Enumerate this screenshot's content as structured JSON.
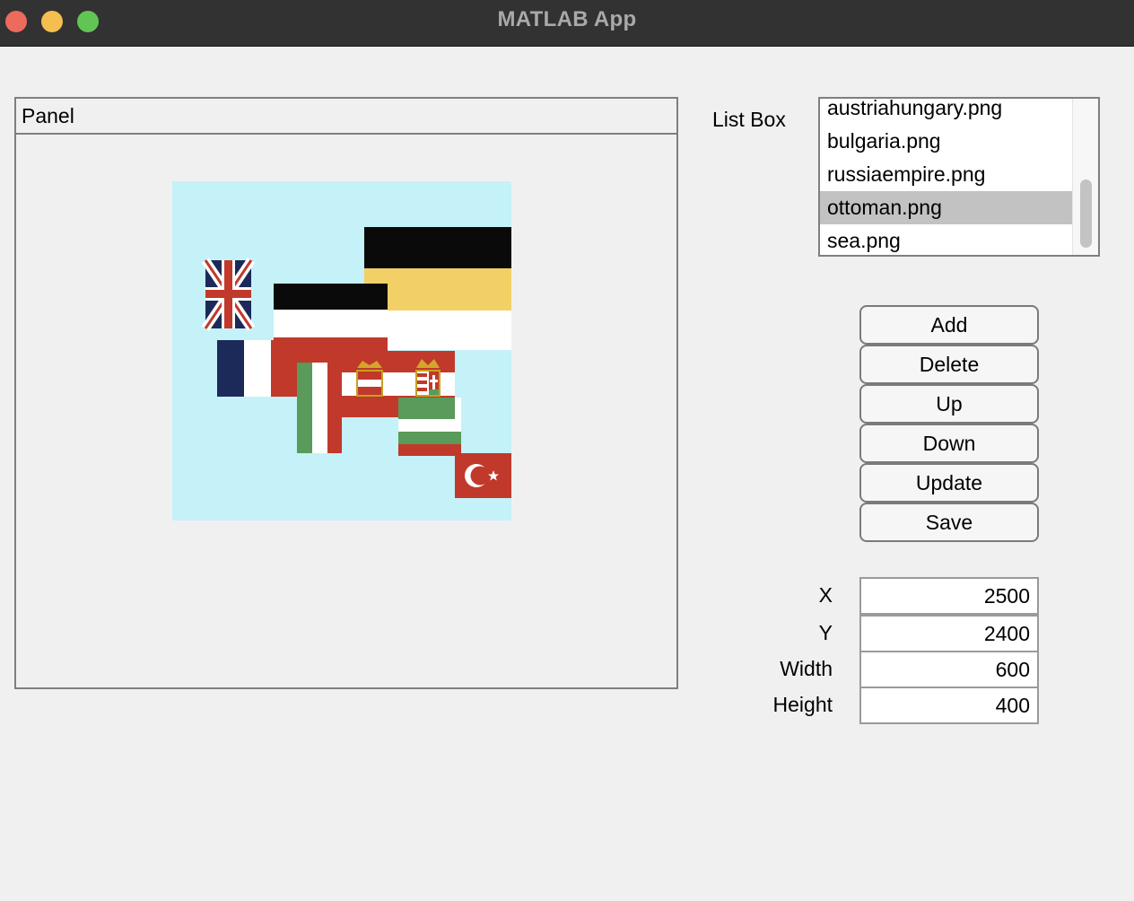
{
  "window": {
    "title": "MATLAB App"
  },
  "panel": {
    "title": "Panel"
  },
  "listbox": {
    "label": "List Box",
    "items": [
      {
        "label": "austriahungary.png",
        "selected": false
      },
      {
        "label": "bulgaria.png",
        "selected": false
      },
      {
        "label": "russiaempire.png",
        "selected": false
      },
      {
        "label": "ottoman.png",
        "selected": true
      },
      {
        "label": "sea.png",
        "selected": false
      }
    ]
  },
  "buttons": {
    "add": "Add",
    "delete": "Delete",
    "up": "Up",
    "down": "Down",
    "update": "Update",
    "save": "Save"
  },
  "fields": {
    "x": {
      "label": "X",
      "value": "2500"
    },
    "y": {
      "label": "Y",
      "value": "2400"
    },
    "width": {
      "label": "Width",
      "value": "600"
    },
    "height": {
      "label": "Height",
      "value": "400"
    }
  },
  "map": {
    "sea_color": "#c5f1f8",
    "flags": [
      "uk",
      "germany",
      "russia",
      "france",
      "italy",
      "austria",
      "hungary",
      "bulgaria",
      "ottoman"
    ]
  },
  "colors": {
    "titlebar": "#323232",
    "close": "#ed6a5e",
    "minimize": "#f5bf4f",
    "maximize": "#61c554",
    "selection": "#c2c2c2",
    "flag_red": "#c0392b",
    "flag_black": "#0a0a0a",
    "flag_gold": "#f2d066",
    "flag_blue": "#1c2a5a",
    "flag_green": "#5a9a5a"
  }
}
